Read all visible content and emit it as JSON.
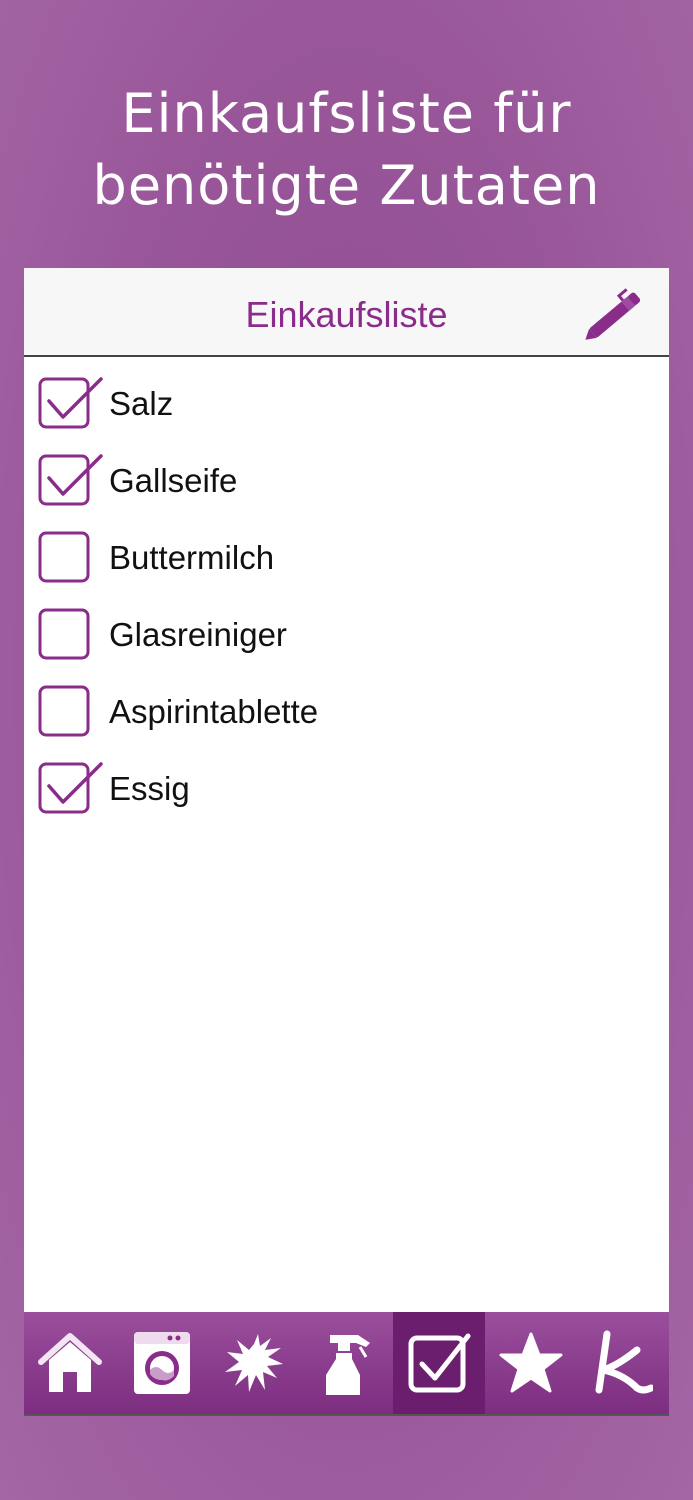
{
  "promo": {
    "headline_line1": "Einkaufsliste für",
    "headline_line2": "benötigte Zutaten"
  },
  "navbar": {
    "title": "Einkaufsliste",
    "edit_icon": "pencil-icon"
  },
  "shopping_list": {
    "items": [
      {
        "label": "Salz",
        "checked": true
      },
      {
        "label": "Gallseife",
        "checked": true
      },
      {
        "label": "Buttermilch",
        "checked": false
      },
      {
        "label": "Glasreiniger",
        "checked": false
      },
      {
        "label": "Aspirintablette",
        "checked": false
      },
      {
        "label": "Essig",
        "checked": true
      }
    ]
  },
  "tabbar": {
    "tabs": [
      {
        "icon": "home-icon",
        "active": false
      },
      {
        "icon": "washing-machine-icon",
        "active": false
      },
      {
        "icon": "stain-splash-icon",
        "active": false
      },
      {
        "icon": "spray-bottle-icon",
        "active": false
      },
      {
        "icon": "checklist-icon",
        "active": true
      },
      {
        "icon": "star-icon",
        "active": false
      },
      {
        "icon": "k-logo-icon",
        "active": false
      }
    ]
  },
  "colors": {
    "background": "#99579a",
    "accent": "#8a2c8a",
    "tabbar_top": "#9a4f9c",
    "tabbar_bottom": "#7d2d80",
    "tab_active": "#6a1e6d"
  }
}
